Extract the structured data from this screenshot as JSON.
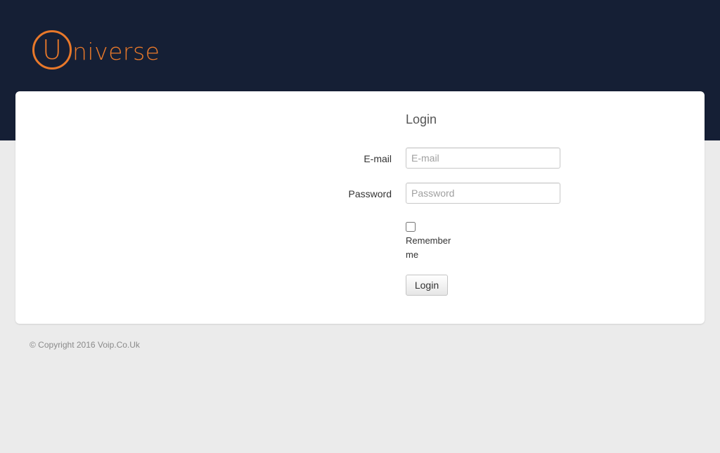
{
  "brand": {
    "logo_letter": "U",
    "logo_rest": "niverse",
    "accent_color": "#e8782a",
    "header_color": "#151f35"
  },
  "login": {
    "title": "Login",
    "email_label": "E-mail",
    "email_placeholder": "E-mail",
    "email_value": "",
    "password_label": "Password",
    "password_placeholder": "Password",
    "password_value": "",
    "remember_label": "Remember me",
    "remember_checked": false,
    "submit_label": "Login"
  },
  "footer": {
    "copyright": "© Copyright 2016 Voip.Co.Uk"
  }
}
